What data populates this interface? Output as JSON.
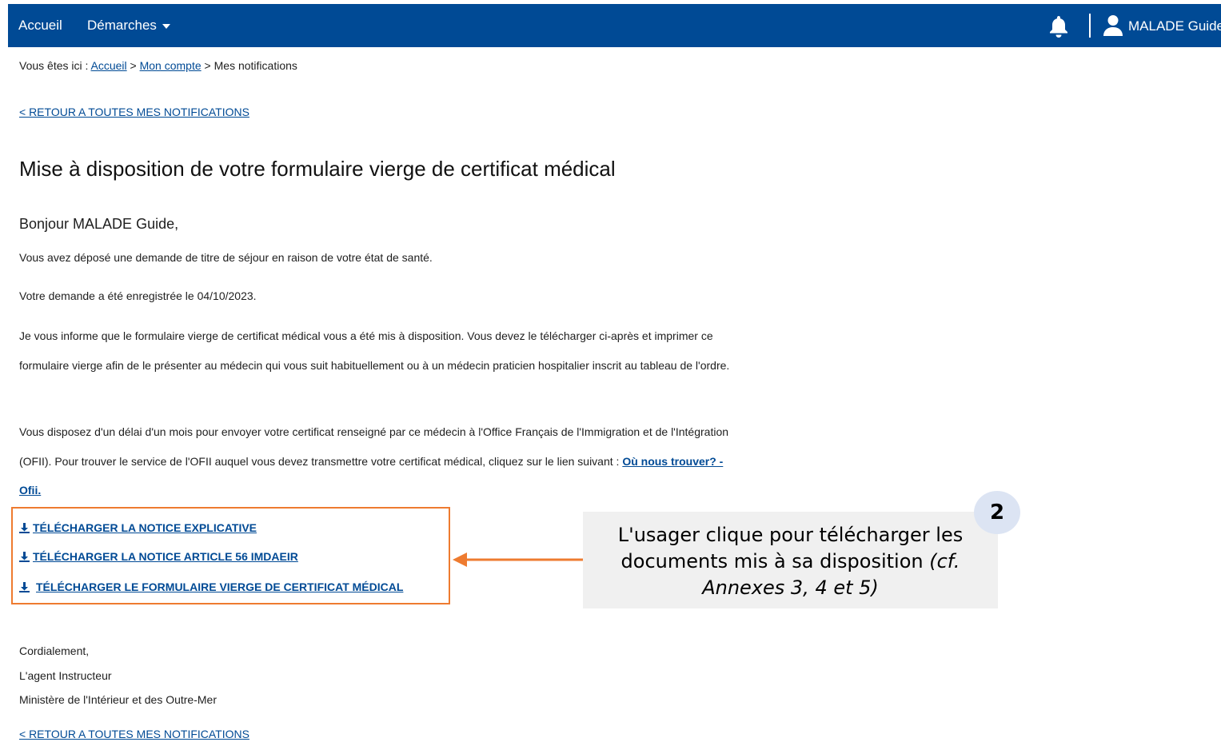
{
  "navbar": {
    "home_label": "Accueil",
    "procedures_label": "Démarches",
    "user_name": "MALADE Guide"
  },
  "breadcrumb": {
    "prefix": "Vous êtes ici : ",
    "items": [
      "Accueil",
      "Mon compte",
      "Mes notifications"
    ],
    "separator": " > "
  },
  "back_link": "< RETOUR A TOUTES MES NOTIFICATIONS",
  "title": "Mise à disposition de votre formulaire vierge de certificat médical",
  "greeting": "Bonjour MALADE Guide,",
  "paragraphs": [
    "Vous avez déposé une demande de titre de séjour en raison de votre état de santé.",
    "Votre demande a été enregistrée le 04/10/2023.",
    "Je vous informe que le formulaire vierge de certificat médical vous a été mis à disposition. Vous devez le télécharger ci-après et imprimer ce formulaire vierge afin de le présenter au médecin qui vous suit habituellement ou à un médecin praticien hospitalier inscrit au tableau de l'ordre.",
    "Vous disposez d'un délai d'un mois pour envoyer votre certificat renseigné par ce médecin à l'Office Français de l'Immigration et de l'Intégration (OFII). Pour trouver le service de l'OFII auquel vous devez transmettre votre certificat médical, cliquez sur le lien suivant : "
  ],
  "ofii_link": "Où nous trouver? - Ofii.",
  "downloads": [
    "TÉLÉCHARGER LA NOTICE EXPLICATIVE",
    "TÉLÉCHARGER LA NOTICE ARTICLE 56 IMDAEIR",
    "TÉLÉCHARGER LE FORMULAIRE VIERGE DE CERTIFICAT MÉDICAL"
  ],
  "callout": {
    "step": "2",
    "line1": "L'usager clique pour télécharger les",
    "line2": "documents mis à sa disposition",
    "line2_italic": " (cf.",
    "line3_italic": "Annexes 3, 4 et 5)"
  },
  "closing": [
    "Cordialement,",
    "L'agent Instructeur",
    "Ministère de l'Intérieur et des Outre-Mer"
  ],
  "colors": {
    "navbar": "#004a95",
    "link": "#004a95",
    "highlight_box": "#ee7b30",
    "callout_bg": "#f0f0f0",
    "badge_bg": "#dce4f3"
  }
}
